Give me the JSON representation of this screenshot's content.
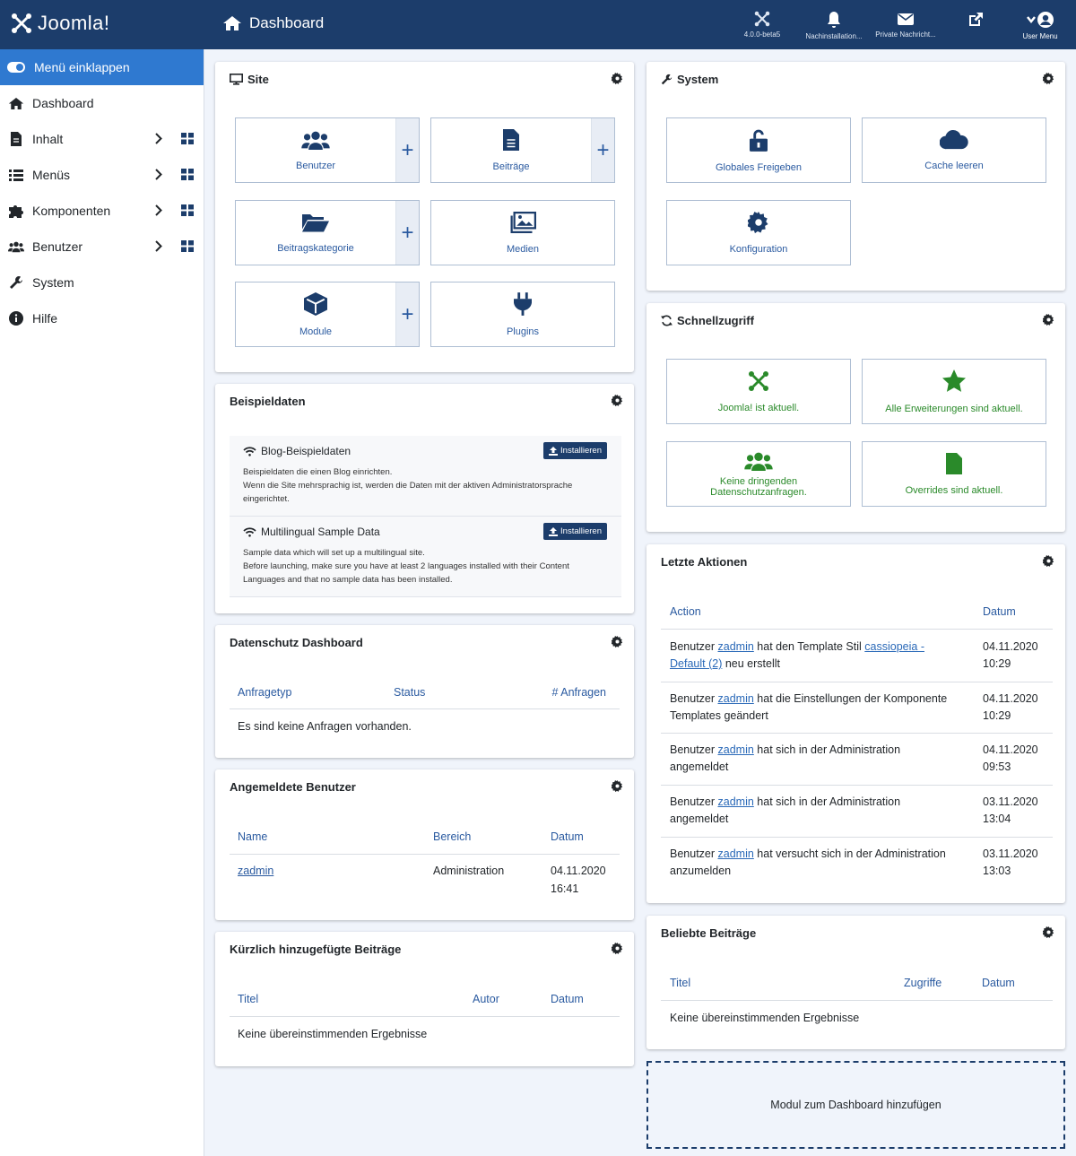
{
  "header": {
    "logo": "Joomla!",
    "page_title": "Dashboard",
    "items": [
      {
        "label": "4.0.0-beta5",
        "icon": "joomla-icon"
      },
      {
        "label": "Nachinstallation...",
        "icon": "bell-icon"
      },
      {
        "label": "Private Nachricht...",
        "icon": "envelope-icon"
      },
      {
        "label": "",
        "icon": "external-link-icon"
      },
      {
        "label": "User Menu",
        "icon": "user-circle-icon"
      }
    ]
  },
  "sidebar": {
    "collapse_label": "Menü einklappen",
    "items": [
      {
        "label": "Dashboard",
        "icon": "home-icon"
      },
      {
        "label": "Inhalt",
        "icon": "file-icon"
      },
      {
        "label": "Menüs",
        "icon": "list-icon"
      },
      {
        "label": "Komponenten",
        "icon": "puzzle-icon"
      },
      {
        "label": "Benutzer",
        "icon": "users-icon"
      },
      {
        "label": "System",
        "icon": "wrench-icon"
      },
      {
        "label": "Hilfe",
        "icon": "info-icon"
      }
    ]
  },
  "site": {
    "title": "Site",
    "tiles": [
      {
        "label": "Benutzer",
        "icon": "users-icon",
        "plus": "+"
      },
      {
        "label": "Beiträge",
        "icon": "file-alt-icon",
        "plus": "+"
      },
      {
        "label": "Beitragskategorie",
        "icon": "folder-open-icon",
        "plus": "+"
      },
      {
        "label": "Medien",
        "icon": "images-icon"
      },
      {
        "label": "Module",
        "icon": "cube-icon",
        "plus": "+"
      },
      {
        "label": "Plugins",
        "icon": "plug-icon"
      }
    ]
  },
  "system": {
    "title": "System",
    "tiles": [
      {
        "label": "Globales Freigeben",
        "icon": "unlock-icon"
      },
      {
        "label": "Cache leeren",
        "icon": "cloud-icon"
      },
      {
        "label": "Konfiguration",
        "icon": "cog-icon"
      }
    ]
  },
  "quick": {
    "title": "Schnellzugriff",
    "tiles": [
      {
        "label": "Joomla! ist aktuell.",
        "icon": "joomla-icon"
      },
      {
        "label": "Alle Erweiterungen sind aktuell.",
        "icon": "star-icon"
      },
      {
        "label": "Keine dringenden Datenschutzanfragen.",
        "icon": "users-icon"
      },
      {
        "label": "Overrides sind aktuell.",
        "icon": "file-icon"
      }
    ]
  },
  "sample_data": {
    "title": "Beispieldaten",
    "items": [
      {
        "name": "Blog-Beispieldaten",
        "button": "Installieren",
        "desc": "Beispieldaten die einen Blog einrichten.\nWenn die Site mehrsprachig ist, werden die Daten mit der aktiven Administratorsprache eingerichtet."
      },
      {
        "name": "Multilingual Sample Data",
        "button": "Installieren",
        "desc": "Sample data which will set up a multilingual site.\nBefore launching, make sure you have at least 2 languages installed with their Content Languages and that no sample data has been installed."
      }
    ]
  },
  "privacy": {
    "title": "Datenschutz Dashboard",
    "columns": [
      "Anfragetyp",
      "Status",
      "# Anfragen"
    ],
    "empty": "Es sind keine Anfragen vorhanden."
  },
  "logged_users": {
    "title": "Angemeldete Benutzer",
    "columns": [
      "Name",
      "Bereich",
      "Datum"
    ],
    "rows": [
      {
        "name": "zadmin",
        "area": "Administration",
        "date": "04.11.2020",
        "time": "16:41"
      }
    ]
  },
  "recent_articles": {
    "title": "Kürzlich hinzugefügte Beiträge",
    "columns": [
      "Titel",
      "Autor",
      "Datum"
    ],
    "empty": "Keine übereinstimmenden Ergebnisse"
  },
  "latest_actions": {
    "title": "Letzte Aktionen",
    "columns": [
      "Action",
      "Datum"
    ],
    "rows": [
      {
        "pre": "Benutzer ",
        "user": "zadmin",
        "mid": " hat den Template Stil ",
        "link": "cassiopeia - Default (2)",
        "post": " neu erstellt",
        "date": "04.11.2020",
        "time": "10:29"
      },
      {
        "pre": "Benutzer ",
        "user": "zadmin",
        "mid": " hat die Einstellungen der Komponente Templates geändert",
        "link": "",
        "post": "",
        "date": "04.11.2020",
        "time": "10:29"
      },
      {
        "pre": "Benutzer ",
        "user": "zadmin",
        "mid": " hat sich in der Administration angemeldet",
        "link": "",
        "post": "",
        "date": "04.11.2020",
        "time": "09:53"
      },
      {
        "pre": "Benutzer ",
        "user": "zadmin",
        "mid": " hat sich in der Administration angemeldet",
        "link": "",
        "post": "",
        "date": "03.11.2020",
        "time": "13:04"
      },
      {
        "pre": "Benutzer ",
        "user": "zadmin",
        "mid": " hat versucht sich in der Administration anzumelden",
        "link": "",
        "post": "",
        "date": "03.11.2020",
        "time": "13:03"
      }
    ]
  },
  "popular": {
    "title": "Beliebte Beiträge",
    "columns": [
      "Titel",
      "Zugriffe",
      "Datum"
    ],
    "empty": "Keine übereinstimmenden Ergebnisse"
  },
  "add_module": "Modul zum Dashboard hinzufügen",
  "colors": {
    "header": "#1c3d6b",
    "accent": "#2f79d0",
    "link": "#2a5aa0",
    "success": "#2a8a2a"
  }
}
